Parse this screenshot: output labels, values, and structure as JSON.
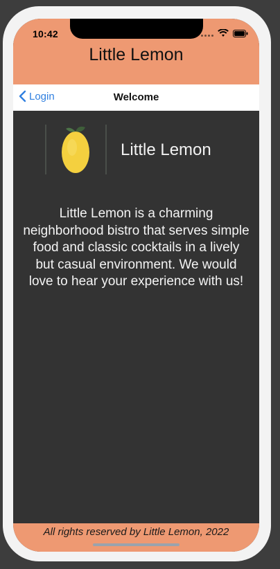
{
  "status_bar": {
    "time": "10:42"
  },
  "header": {
    "title": "Little Lemon"
  },
  "navbar": {
    "back_label": "Login",
    "title": "Welcome"
  },
  "logo": {
    "brand_text": "Little Lemon",
    "icon": "lemon-icon"
  },
  "content": {
    "description": "Little Lemon is a charming neighborhood bistro that serves simple food and classic cocktails in a lively but casual environment. We would love to hear your experience with us!"
  },
  "footer": {
    "text": "All rights reserved by Little Lemon, 2022"
  },
  "colors": {
    "brand_orange": "#ee9972",
    "background": "#333333",
    "link_blue": "#2f7fe0",
    "lemon_yellow": "#f4d03f",
    "leaf_green": "#3f5f3a"
  }
}
